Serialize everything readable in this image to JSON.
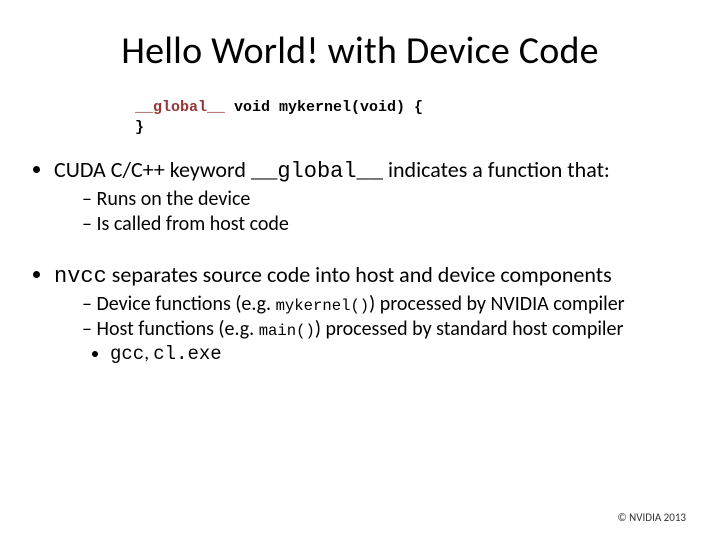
{
  "title": "Hello World! with Device Code",
  "code": {
    "kw": "__global__",
    "rest": " void mykernel(void) {",
    "line2": "}"
  },
  "b1": {
    "pre": "CUDA C/C++ keyword ",
    "mono": "__global__",
    "post": " indicates a function that:",
    "sub1": "Runs on the device",
    "sub2": "Is called from host code"
  },
  "b2": {
    "mono": "nvcc",
    "post": " separates source code into host and device components",
    "sub1_pre": "Device functions (e.g. ",
    "sub1_mono": "mykernel()",
    "sub1_post": ") processed by NVIDIA compiler",
    "sub2_pre": "Host functions (e.g. ",
    "sub2_mono": "main()",
    "sub2_post": ") processed by standard host compiler",
    "sub3_mono1": "gcc",
    "sub3_sep": ", ",
    "sub3_mono2": "cl.exe"
  },
  "footer": "© NVIDIA 2013"
}
